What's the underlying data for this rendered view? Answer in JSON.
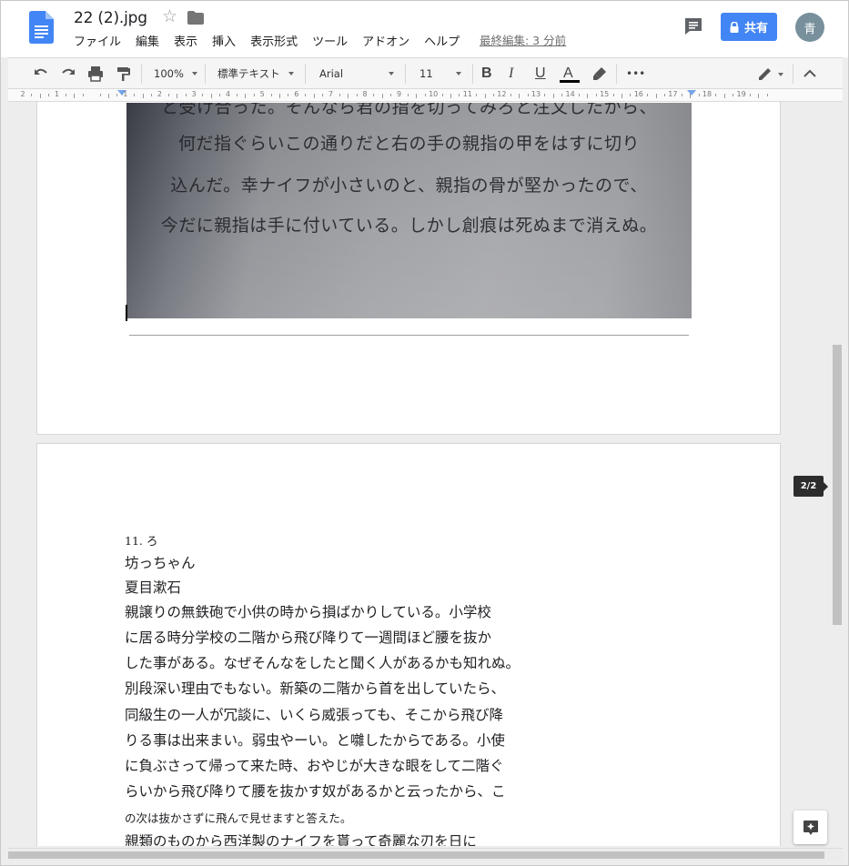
{
  "app": {
    "doc_title": "22 (2).jpg",
    "menu": [
      "ファイル",
      "編集",
      "表示",
      "挿入",
      "表示形式",
      "ツール",
      "アドオン",
      "ヘルプ"
    ],
    "last_edit": "最終編集: 3 分前",
    "share_label": "共有",
    "avatar_initial": "青",
    "brand_color": "#4285f4"
  },
  "toolbar": {
    "zoom": "100%",
    "style": "標準テキスト",
    "font": "Arial",
    "size": "11",
    "bold": "B",
    "italic": "I",
    "underline": "U",
    "text_color_letter": "A",
    "more": "•••",
    "icons": [
      "undo-icon",
      "redo-icon",
      "print-icon",
      "paint-format-icon",
      "highlighter-icon",
      "pencil-icon",
      "chevron-up-icon"
    ]
  },
  "ruler": {
    "labels": [
      "2",
      "1",
      "",
      "1",
      "2",
      "3",
      "4",
      "5",
      "6",
      "7",
      "8",
      "9",
      "10",
      "11",
      "12",
      "13",
      "14",
      "15",
      "16",
      "17",
      "18",
      "19"
    ]
  },
  "page1": {
    "photo_lines": [
      "と受け合った。そんなら君の指を切ってみろと注文したから、",
      "何だ指ぐらいこの通りだと右の手の親指の甲をはすに切り",
      "込んだ。幸ナイフが小さいのと、親指の骨が堅かったので、",
      "今だに親指は手に付いている。しかし創痕は死ぬまで消えぬ。"
    ]
  },
  "page2": {
    "lines": [
      "11. ろ",
      "坊っちゃん",
      "夏目漱石",
      "親譲りの無鉄砲で小供の時から損ばかりしている。小学校",
      "に居る時分学校の二階から飛び降りて一週間ほど腰を抜か",
      "した事がある。なぜそんなをしたと聞く人があるかも知れぬ。",
      "別段深い理由でもない。新築の二階から首を出していたら、",
      "同級生の一人が冗談に、いくら威張っても、そこから飛び降",
      "りる事は出来まい。弱虫やーい。と囃したからである。小使",
      "に負ぶさって帰って来た時、おやじが大きな眼をして二階ぐ",
      "らいから飛び降りて腰を抜かす奴があるかと云ったから、こ",
      "の次は抜かさずに飛んで見せますと答えた。",
      "親類のものから西洋製のナイフを貰って奇麗な刃を日に"
    ]
  },
  "page_indicator": "2/2"
}
